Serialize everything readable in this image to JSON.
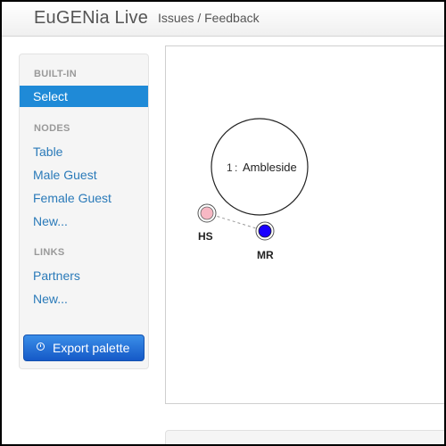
{
  "app": {
    "title": "EuGENia Live"
  },
  "nav": {
    "issues_label": "Issues / Feedback"
  },
  "sidebar": {
    "builtin_header": "BUILT-IN",
    "select_label": "Select",
    "nodes_header": "NODES",
    "nodes": [
      "Table",
      "Male Guest",
      "Female Guest",
      "New..."
    ],
    "links_header": "LINKS",
    "links": [
      "Partners",
      "New..."
    ],
    "export_label": "Export palette",
    "export_icon": "download-circle-icon"
  },
  "diagram": {
    "table": {
      "number": "1",
      "separator": ":",
      "name": "Ambleside"
    },
    "female_guest": {
      "label": "HS",
      "color": "#f7b8c4"
    },
    "male_guest": {
      "label": "MR",
      "color": "#1a00ff"
    },
    "link_style": "dashed"
  },
  "colors": {
    "accent": "#1f8ad7",
    "link": "#2a7ab9",
    "export_button": "#2a6fdb"
  }
}
